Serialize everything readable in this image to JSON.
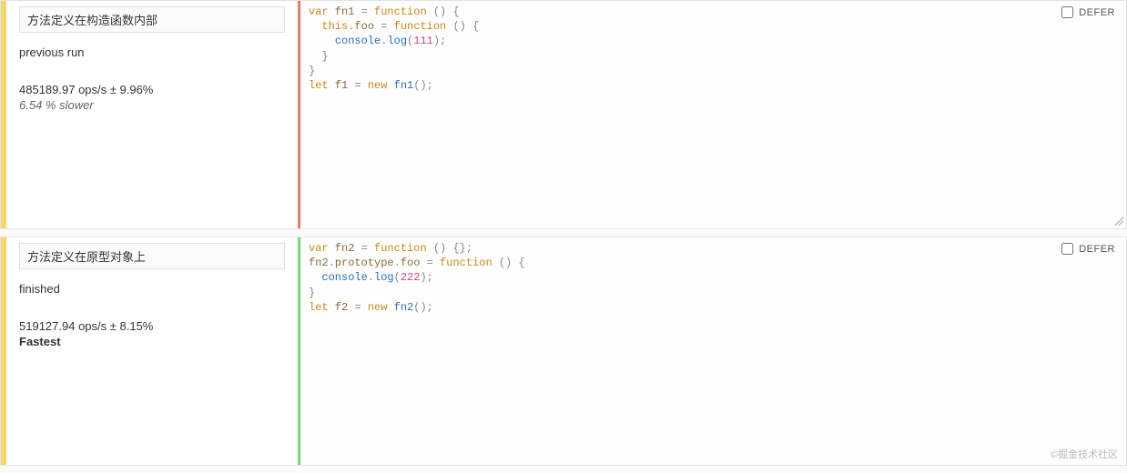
{
  "tests": [
    {
      "title": "方法定义在构造函数内部",
      "status": "previous run",
      "ops": "485189.97 ops/s ± 9.96%",
      "result": "6.54 % slower",
      "result_kind": "slower",
      "divider_color": "red",
      "defer_label": "DEFER",
      "defer_checked": false,
      "code": [
        {
          "t": "kw",
          "v": "var"
        },
        {
          "t": "pl",
          "v": " "
        },
        {
          "t": "id",
          "v": "fn1"
        },
        {
          "t": "pl",
          "v": " "
        },
        {
          "t": "op",
          "v": "="
        },
        {
          "t": "pl",
          "v": " "
        },
        {
          "t": "kw",
          "v": "function"
        },
        {
          "t": "pl",
          "v": " "
        },
        {
          "t": "op",
          "v": "()"
        },
        {
          "t": "pl",
          "v": " "
        },
        {
          "t": "op",
          "v": "{"
        },
        {
          "t": "pl",
          "v": "\n  "
        },
        {
          "t": "kw",
          "v": "this"
        },
        {
          "t": "op",
          "v": "."
        },
        {
          "t": "id",
          "v": "foo"
        },
        {
          "t": "pl",
          "v": " "
        },
        {
          "t": "op",
          "v": "="
        },
        {
          "t": "pl",
          "v": " "
        },
        {
          "t": "kw",
          "v": "function"
        },
        {
          "t": "pl",
          "v": " "
        },
        {
          "t": "op",
          "v": "()"
        },
        {
          "t": "pl",
          "v": " "
        },
        {
          "t": "op",
          "v": "{"
        },
        {
          "t": "pl",
          "v": "\n    "
        },
        {
          "t": "fn",
          "v": "console"
        },
        {
          "t": "op",
          "v": "."
        },
        {
          "t": "fn",
          "v": "log"
        },
        {
          "t": "op",
          "v": "("
        },
        {
          "t": "num",
          "v": "111"
        },
        {
          "t": "op",
          "v": ");"
        },
        {
          "t": "pl",
          "v": "\n  "
        },
        {
          "t": "op",
          "v": "}"
        },
        {
          "t": "pl",
          "v": "\n"
        },
        {
          "t": "op",
          "v": "}"
        },
        {
          "t": "pl",
          "v": "\n"
        },
        {
          "t": "kw",
          "v": "let"
        },
        {
          "t": "pl",
          "v": " "
        },
        {
          "t": "id",
          "v": "f1"
        },
        {
          "t": "pl",
          "v": " "
        },
        {
          "t": "op",
          "v": "="
        },
        {
          "t": "pl",
          "v": " "
        },
        {
          "t": "kw",
          "v": "new"
        },
        {
          "t": "pl",
          "v": " "
        },
        {
          "t": "fn",
          "v": "fn1"
        },
        {
          "t": "op",
          "v": "();"
        }
      ]
    },
    {
      "title": "方法定义在原型对象上",
      "status": "finished",
      "ops": "519127.94 ops/s ± 8.15%",
      "result": "Fastest",
      "result_kind": "fastest",
      "divider_color": "green",
      "defer_label": "DEFER",
      "defer_checked": false,
      "code": [
        {
          "t": "kw",
          "v": "var"
        },
        {
          "t": "pl",
          "v": " "
        },
        {
          "t": "id",
          "v": "fn2"
        },
        {
          "t": "pl",
          "v": " "
        },
        {
          "t": "op",
          "v": "="
        },
        {
          "t": "pl",
          "v": " "
        },
        {
          "t": "kw",
          "v": "function"
        },
        {
          "t": "pl",
          "v": " "
        },
        {
          "t": "op",
          "v": "()"
        },
        {
          "t": "pl",
          "v": " "
        },
        {
          "t": "op",
          "v": "{};"
        },
        {
          "t": "pl",
          "v": "\n"
        },
        {
          "t": "id",
          "v": "fn2"
        },
        {
          "t": "op",
          "v": "."
        },
        {
          "t": "id",
          "v": "prototype"
        },
        {
          "t": "op",
          "v": "."
        },
        {
          "t": "id",
          "v": "foo"
        },
        {
          "t": "pl",
          "v": " "
        },
        {
          "t": "op",
          "v": "="
        },
        {
          "t": "pl",
          "v": " "
        },
        {
          "t": "kw",
          "v": "function"
        },
        {
          "t": "pl",
          "v": " "
        },
        {
          "t": "op",
          "v": "()"
        },
        {
          "t": "pl",
          "v": " "
        },
        {
          "t": "op",
          "v": "{"
        },
        {
          "t": "pl",
          "v": "\n  "
        },
        {
          "t": "fn",
          "v": "console"
        },
        {
          "t": "op",
          "v": "."
        },
        {
          "t": "fn",
          "v": "log"
        },
        {
          "t": "op",
          "v": "("
        },
        {
          "t": "num",
          "v": "222"
        },
        {
          "t": "op",
          "v": ");"
        },
        {
          "t": "pl",
          "v": "\n"
        },
        {
          "t": "op",
          "v": "}"
        },
        {
          "t": "pl",
          "v": "\n"
        },
        {
          "t": "kw",
          "v": "let"
        },
        {
          "t": "pl",
          "v": " "
        },
        {
          "t": "id",
          "v": "f2"
        },
        {
          "t": "pl",
          "v": " "
        },
        {
          "t": "op",
          "v": "="
        },
        {
          "t": "pl",
          "v": " "
        },
        {
          "t": "kw",
          "v": "new"
        },
        {
          "t": "pl",
          "v": " "
        },
        {
          "t": "fn",
          "v": "fn2"
        },
        {
          "t": "op",
          "v": "();"
        }
      ]
    }
  ],
  "watermark": "©掘金技术社区"
}
